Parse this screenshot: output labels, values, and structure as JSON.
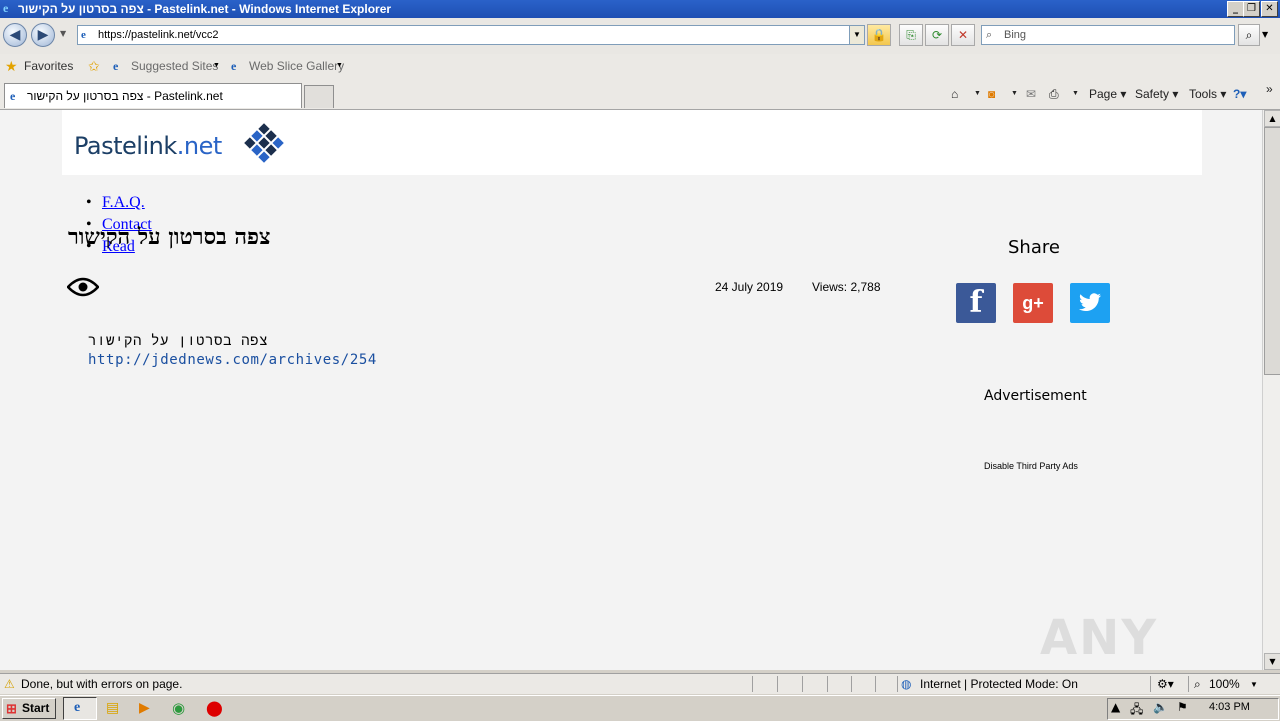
{
  "window": {
    "title": "צפה בסרטון על הקישור - Pastelink.net - Windows Internet Explorer"
  },
  "nav": {
    "url": "https://pastelink.net/vcc2",
    "search_placeholder": "Bing"
  },
  "favorites_bar": {
    "favorites": "Favorites",
    "suggested": "Suggested Sites",
    "web_slice": "Web Slice Gallery"
  },
  "tabs": [
    {
      "label": "צפה בסרטון על הקישור - Pastelink.net"
    }
  ],
  "command_bar": {
    "page": "Page",
    "safety": "Safety",
    "tools": "Tools"
  },
  "site": {
    "logo_main": "Pastelink",
    "logo_suffix": ".net",
    "menu": [
      {
        "label": "F.A.Q."
      },
      {
        "label": "Contact"
      },
      {
        "label": "Read"
      }
    ],
    "paste_title": "צפה בסרטון על הקישור",
    "date": "24 July 2019",
    "views": "Views: 2,788",
    "content_line1": "צפה בסרטון על הקישור",
    "content_link": "http://jdednews.com/archives/254",
    "share_title": "Share",
    "advertisement": "Advertisement",
    "disable_ads": "Disable Third Party Ads",
    "share_colors": {
      "facebook": "#3b5998",
      "googleplus": "#dd4b39",
      "twitter": "#1da1f2"
    }
  },
  "watermark": "ANY RUN",
  "status": {
    "message": "Done, but with errors on page.",
    "zone": "Internet | Protected Mode: On",
    "zoom": "100%"
  },
  "taskbar": {
    "start": "Start",
    "clock": "4:03 PM"
  }
}
